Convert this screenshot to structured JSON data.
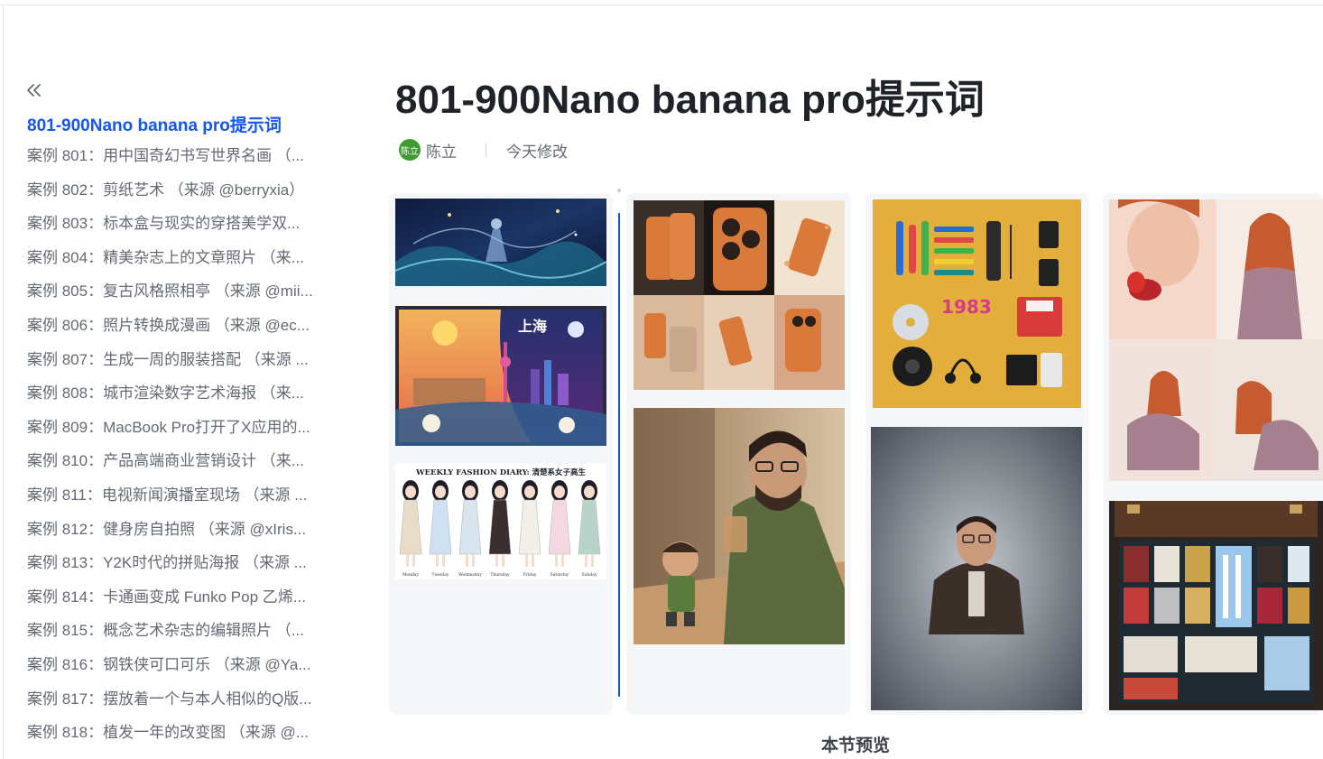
{
  "page": {
    "title": "801-900Nano banana pro提示词",
    "author": "陈立",
    "avatar_text": "陈立",
    "modified": "今天修改"
  },
  "toc": {
    "active": "801-900Nano banana pro提示词",
    "items": [
      "案例 801：用中国奇幻书写世界名画 （...",
      "案例 802：剪纸艺术 （来源 @berryxia）",
      "案例 803：标本盒与现实的穿搭美学双...",
      "案例 804：精美杂志上的文章照片 （来...",
      "案例 805：复古风格照相亭 （来源 @mii...",
      "案例 806：照片转换成漫画 （来源 @ec...",
      "案例 807：生成一周的服装搭配 （来源 ...",
      "案例 808：城市渲染数字艺术海报 （来...",
      "案例 809：MacBook Pro打开了X应用的...",
      "案例 810：产品高端商业营销设计 （来...",
      "案例 811：电视新闻演播室现场 （来源 ...",
      "案例 812：健身房自拍照 （来源 @xIris...",
      "案例 813：Y2K时代的拼贴海报 （来源 ...",
      "案例 814：卡通画变成 Funko Pop 乙烯...",
      "案例 815：概念艺术杂志的编辑照片 （...",
      "案例 816：钢铁侠可口可乐 （来源 @Ya...",
      "案例 817：摆放着一个与本人相似的Q版...",
      "案例 818：植发一年的改变图 （来源 @..."
    ]
  },
  "gallery": {
    "shanghai_text": "上海",
    "fashion_title": "WEEKLY FASHION DIARY: 清楚系女子高生",
    "days": [
      "Monday",
      "Tuesday",
      "Wednesday",
      "Thursday",
      "Friday",
      "Saturday",
      "Sunday"
    ],
    "year_text": "1983",
    "caption": "本节预览"
  },
  "colors": {
    "accent": "#1456f0",
    "text_secondary": "#646a73",
    "avatar_bg": "#3d9b2f",
    "orange_phone": "#d9793a",
    "mustard_bg": "#e3ae3c"
  }
}
